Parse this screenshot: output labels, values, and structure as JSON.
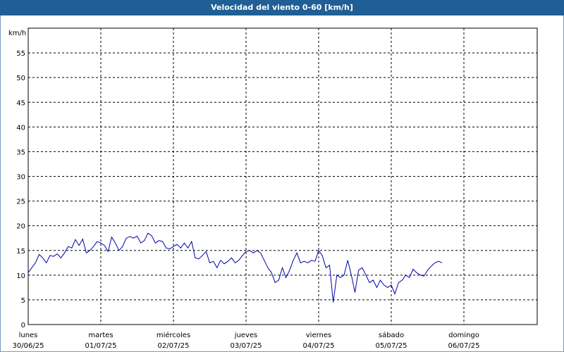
{
  "chart_data": {
    "type": "line",
    "title": "Velocidad del viento 0-60 [km/h]",
    "ylabel": "km/h",
    "ylim": [
      0,
      60
    ],
    "yticks": [
      0,
      5,
      10,
      15,
      20,
      25,
      30,
      35,
      40,
      45,
      50,
      55
    ],
    "grid": true,
    "line_color": "#0000aa",
    "x_labels": [
      {
        "day": "lunes",
        "date": "30/06/25"
      },
      {
        "day": "martes",
        "date": "01/07/25"
      },
      {
        "day": "miércoles",
        "date": "02/07/25"
      },
      {
        "day": "jueves",
        "date": "03/07/25"
      },
      {
        "day": "viernes",
        "date": "04/07/25"
      },
      {
        "day": "sábado",
        "date": "05/07/25"
      },
      {
        "day": "domingo",
        "date": "06/07/25"
      }
    ],
    "x_unit": "days since 30/06/25 00:00",
    "series": [
      {
        "x": [
          0.0,
          0.05,
          0.1,
          0.15,
          0.2,
          0.25,
          0.3,
          0.35,
          0.4,
          0.45,
          0.5,
          0.55,
          0.6,
          0.65,
          0.7,
          0.75,
          0.8,
          0.85,
          0.9,
          0.95,
          1.0,
          1.05,
          1.1,
          1.15,
          1.2,
          1.25,
          1.3,
          1.35,
          1.4,
          1.45,
          1.5,
          1.55,
          1.6,
          1.65,
          1.7,
          1.75,
          1.8,
          1.85,
          1.9,
          1.95,
          2.0,
          2.05,
          2.1,
          2.15,
          2.2,
          2.25,
          2.3,
          2.35,
          2.4,
          2.45,
          2.5,
          2.55,
          2.6,
          2.65,
          2.7,
          2.75,
          2.8,
          2.85,
          2.9,
          2.95,
          3.0,
          3.05,
          3.1,
          3.15,
          3.2,
          3.25,
          3.3,
          3.35,
          3.4,
          3.45,
          3.5,
          3.55,
          3.6,
          3.65,
          3.7,
          3.75,
          3.8,
          3.85,
          3.9,
          3.95,
          4.0,
          4.05,
          4.1,
          4.15,
          4.2,
          4.25,
          4.3,
          4.35,
          4.4,
          4.45,
          4.5,
          4.55,
          4.6,
          4.65,
          4.7,
          4.75,
          4.8,
          4.85,
          4.9,
          4.95,
          5.0,
          5.05,
          5.1,
          5.15,
          5.2,
          5.25,
          5.3,
          5.35,
          5.4,
          5.45,
          5.5,
          5.55,
          5.6,
          5.65,
          5.7
        ],
        "y": [
          10.5,
          11.5,
          12.5,
          14.2,
          13.5,
          12.5,
          14.0,
          13.8,
          14.3,
          13.5,
          14.5,
          15.8,
          15.5,
          17.2,
          16.0,
          17.3,
          14.5,
          15.0,
          15.8,
          16.8,
          16.5,
          16.0,
          14.8,
          17.7,
          16.5,
          15.0,
          15.8,
          17.5,
          17.8,
          17.5,
          17.9,
          16.5,
          17.0,
          18.5,
          18.0,
          16.5,
          17.0,
          16.8,
          15.5,
          15.3,
          15.8,
          16.2,
          15.5,
          16.5,
          15.5,
          16.8,
          13.5,
          13.3,
          14.0,
          14.8,
          12.5,
          12.8,
          11.5,
          13.0,
          12.3,
          12.8,
          13.5,
          12.5,
          13.0,
          14.0,
          14.8,
          15.0,
          14.5,
          15.0,
          14.5,
          13.0,
          11.5,
          10.5,
          8.5,
          9.0,
          11.5,
          9.5,
          11.0,
          13.0,
          14.5,
          12.5,
          12.8,
          12.5,
          13.0,
          12.8,
          15.0,
          14.0,
          11.5,
          12.0,
          4.5,
          10.0,
          9.5,
          10.0,
          13.0,
          10.0,
          6.5,
          11.0,
          11.5,
          10.0,
          8.5,
          9.0,
          7.5,
          9.0,
          8.0,
          7.5,
          8.0,
          6.2,
          8.5,
          9.0,
          10.0,
          9.5,
          11.2,
          10.5,
          10.0,
          9.8,
          11.0,
          11.8,
          12.5,
          12.8,
          12.5
        ]
      }
    ]
  }
}
